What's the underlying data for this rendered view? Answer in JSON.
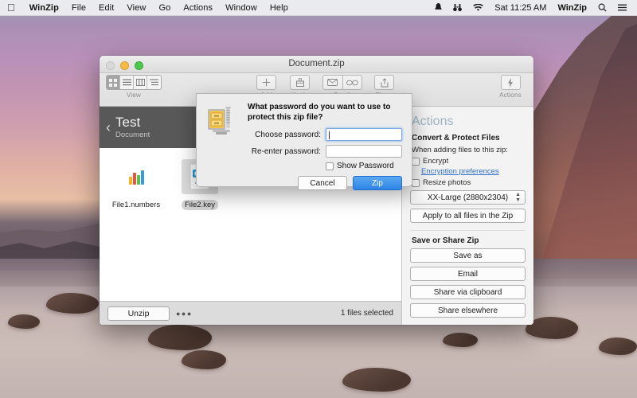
{
  "menubar": {
    "apple_icon": "apple-logo",
    "items": [
      "WinZip",
      "File",
      "Edit",
      "View",
      "Go",
      "Actions",
      "Window",
      "Help"
    ],
    "right": {
      "icons": [
        "dropbox-icon",
        "binoculars-icon",
        "wifi-icon"
      ],
      "clock": "Sat 11:25 AM",
      "app": "WinZip",
      "search_icon": "search-icon",
      "notification_icon": "notification-center-icon"
    }
  },
  "window": {
    "title": "Document.zip",
    "toolbar": {
      "view_label": "View",
      "view_modes": [
        "icon-view",
        "list-view",
        "column-view",
        "detail-view"
      ],
      "active_view": 0,
      "buttons": [
        {
          "label": "Add",
          "icon": "plus-icon"
        },
        {
          "label": "Unzip",
          "icon": "unzip-box-icon"
        },
        {
          "label": "Email",
          "icon": "envelope-icon"
        },
        {
          "label": "Share",
          "icon": "share-arrow-icon"
        }
      ],
      "link_icon": "link-icon",
      "actions_label": "Actions",
      "actions_icon": "lightning-bolt-icon"
    },
    "breadcrumb": {
      "back_icon": "chevron-left-icon",
      "title": "Test",
      "subtitle": "Document"
    },
    "files": [
      {
        "name": "File1.numbers",
        "icon": "numbers-chart-icon",
        "selected": false
      },
      {
        "name": "File2.key",
        "icon": "keynote-podium-icon",
        "selected": true
      }
    ],
    "statusbar": {
      "unzip_label": "Unzip",
      "more_icon": "ellipsis-icon",
      "status": "1 files selected"
    }
  },
  "actions_pane": {
    "title": "Actions",
    "convert_section": {
      "heading": "Convert & Protect Files",
      "subtext": "When adding files to this zip:",
      "encrypt_label": "Encrypt",
      "encryption_link": "Encryption preferences",
      "resize_label": "Resize photos",
      "size_value": "XX-Large (2880x2304)",
      "apply_button": "Apply to all files in the Zip"
    },
    "share_section": {
      "heading": "Save or Share Zip",
      "buttons": [
        "Save as",
        "Email",
        "Share via clipboard",
        "Share elsewhere"
      ]
    }
  },
  "sheet": {
    "icon": "winzip-icon",
    "question": "What password do you want to use to protect this zip file?",
    "fields": [
      {
        "label": "Choose password:",
        "value": "",
        "focused": true
      },
      {
        "label": "Re-enter password:",
        "value": "",
        "focused": false
      }
    ],
    "show_password_label": "Show Password",
    "show_password_checked": false,
    "cancel_label": "Cancel",
    "confirm_label": "Zip"
  },
  "colors": {
    "accent_blue": "#2f83e4",
    "link_blue": "#2f6fd0",
    "breadcrumb_bg": "#585858",
    "actions_title": "#9fb4c6"
  }
}
